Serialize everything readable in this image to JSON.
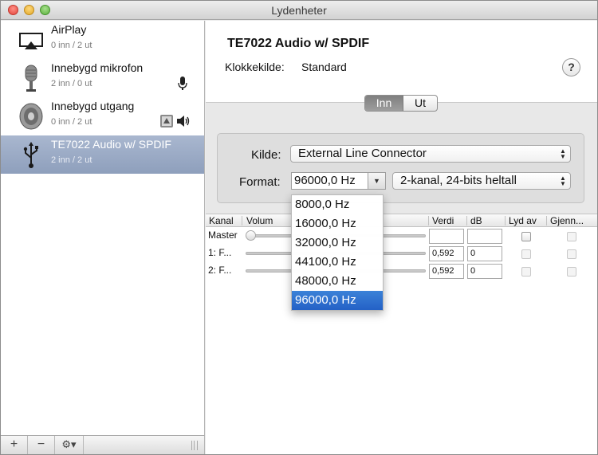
{
  "window": {
    "title": "Lydenheter"
  },
  "sidebar": {
    "devices": [
      {
        "name": "AirPlay",
        "channels": "0 inn / 2 ut",
        "icon": "airplay-icon"
      },
      {
        "name": "Innebygd mikrofon",
        "channels": "2 inn / 0 ut",
        "icon": "microphone-icon"
      },
      {
        "name": "Innebygd utgang",
        "channels": "0 inn / 2 ut",
        "icon": "speaker-icon"
      },
      {
        "name": "TE7022 Audio w/ SPDIF",
        "channels": "2 inn / 2 ut",
        "icon": "usb-icon",
        "selected": true
      }
    ],
    "footer": {
      "add": "+",
      "remove": "−",
      "gear": "⚙▾"
    }
  },
  "main": {
    "device_title": "TE7022 Audio w/ SPDIF",
    "clock_label": "Klokkekilde:",
    "clock_value": "Standard",
    "help": "?",
    "segments": {
      "input": "Inn",
      "output": "Ut",
      "selected": "Inn"
    },
    "source_label": "Kilde:",
    "source_value": "External Line Connector",
    "format_label": "Format:",
    "format_rate": "96000,0 Hz",
    "format_channels": "2-kanal, 24-bits heltall",
    "table": {
      "headers": [
        "Kanal",
        "Volum",
        "Verdi",
        "dB",
        "Lyd av",
        "Gjenn..."
      ],
      "rows": [
        {
          "channel": "Master",
          "value": "",
          "db": ""
        },
        {
          "channel": "1: F...",
          "value": "0,592",
          "db": "0"
        },
        {
          "channel": "2: F...",
          "value": "0,592",
          "db": "0"
        }
      ]
    }
  },
  "dropdown": {
    "options": [
      "8000,0 Hz",
      "16000,0 Hz",
      "32000,0 Hz",
      "44100,0 Hz",
      "48000,0 Hz",
      "96000,0 Hz"
    ],
    "selected": "96000,0 Hz"
  },
  "colors": {
    "selection": "#2461c6",
    "sidebar_selection": "#9aa9c4"
  }
}
